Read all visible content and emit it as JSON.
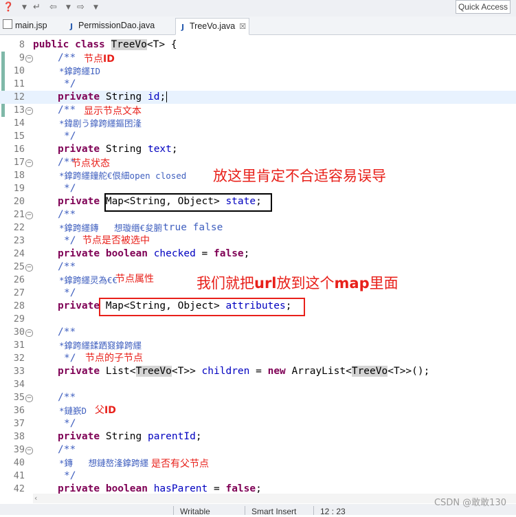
{
  "toolbar": {
    "icons": [
      "help-icon",
      "dropdown-icon",
      "last-edit-icon",
      "back-icon",
      "dropdown-icon",
      "forward-icon",
      "dropdown-icon"
    ],
    "quick_access": "Quick Access"
  },
  "tabs": [
    {
      "label": "main.jsp",
      "icon": "jsp-file-icon"
    },
    {
      "label": "PermissionDao.java",
      "icon": "java-file-icon"
    },
    {
      "label": "TreeVo.java",
      "icon": "java-file-icon",
      "active": true,
      "close": "☒"
    }
  ],
  "line_numbers": [
    "8",
    "9",
    "10",
    "11",
    "12",
    "13",
    "14",
    "15",
    "16",
    "17",
    "18",
    "19",
    "20",
    "21",
    "22",
    "23",
    "24",
    "25",
    "26",
    "27",
    "28",
    "29",
    "30",
    "31",
    "32",
    "33",
    "34",
    "35",
    "36",
    "37",
    "38",
    "39",
    "40",
    "41",
    "42"
  ],
  "code": {
    "l8": [
      "public",
      "class",
      "TreeVo",
      "<T> {"
    ],
    "comment_open": "/**",
    "comment_close": "*/",
    "l10": "*鎿跨纆ID",
    "l12": [
      "private",
      "String",
      "id",
      ";"
    ],
    "l14": "*鍏剧う鎿跨纆鏂囨湰",
    "l16": [
      "private",
      "String",
      "text",
      ";"
    ],
    "l18": "*鎿跨纆鐘舵€佷細open closed",
    "l20": [
      "private",
      "Map<String, Object>",
      "state",
      ";"
    ],
    "l22": "*鎿跨纆鏄   想璇缗€夋腑",
    "l22_code": "true false",
    "l24": [
      "private",
      "boolean",
      "checked",
      "=",
      "false",
      ";"
    ],
    "l26": "*鎿跨纆灵為€€",
    "l28": [
      "private",
      "Map<String, Object>",
      "attributes",
      ";"
    ],
    "l31": "*鎿跨纆鍒跴窡鎿跨纆",
    "l33": [
      "private",
      "List<",
      "TreeVo",
      "<T>>",
      "children",
      "=",
      "new",
      "ArrayList<",
      "TreeVo",
      "<T>>();"
    ],
    "l36": "*鏈嶔D",
    "l38": [
      "private",
      "String",
      "parentId",
      ";"
    ],
    "l40": "*鏄   想鏈嶅湰鎿跨纆",
    "l42": [
      "private",
      "boolean",
      "hasParent",
      "=",
      "false",
      ";"
    ]
  },
  "annotations": {
    "a9": "节点",
    "a9b": "ID",
    "a13": "显示节点文本",
    "a17": "节点状态",
    "big1": "放这里肯定不合适容易误导",
    "a23": "节点是否被选中",
    "a26": "节点属性",
    "big2_a": "我们就把",
    "big2_b": "url",
    "big2_c": "放到这个",
    "big2_d": "map",
    "big2_e": "里面",
    "a32": "节点的子节点",
    "a36": "父",
    "a36b": "ID",
    "a40": "是否有父节点"
  },
  "status": {
    "writable": "Writable",
    "insert_mode": "Smart Insert",
    "position": "12 : 23"
  },
  "watermark": "CSDN @敢敢130",
  "colors": {
    "keyword": "#7f0055",
    "field": "#0000c0",
    "comment": "#3f5fbf",
    "annotation": "#e8201a",
    "black_box": "#000000",
    "red_box": "#e8201a",
    "current_line": "#e8f2fe"
  }
}
